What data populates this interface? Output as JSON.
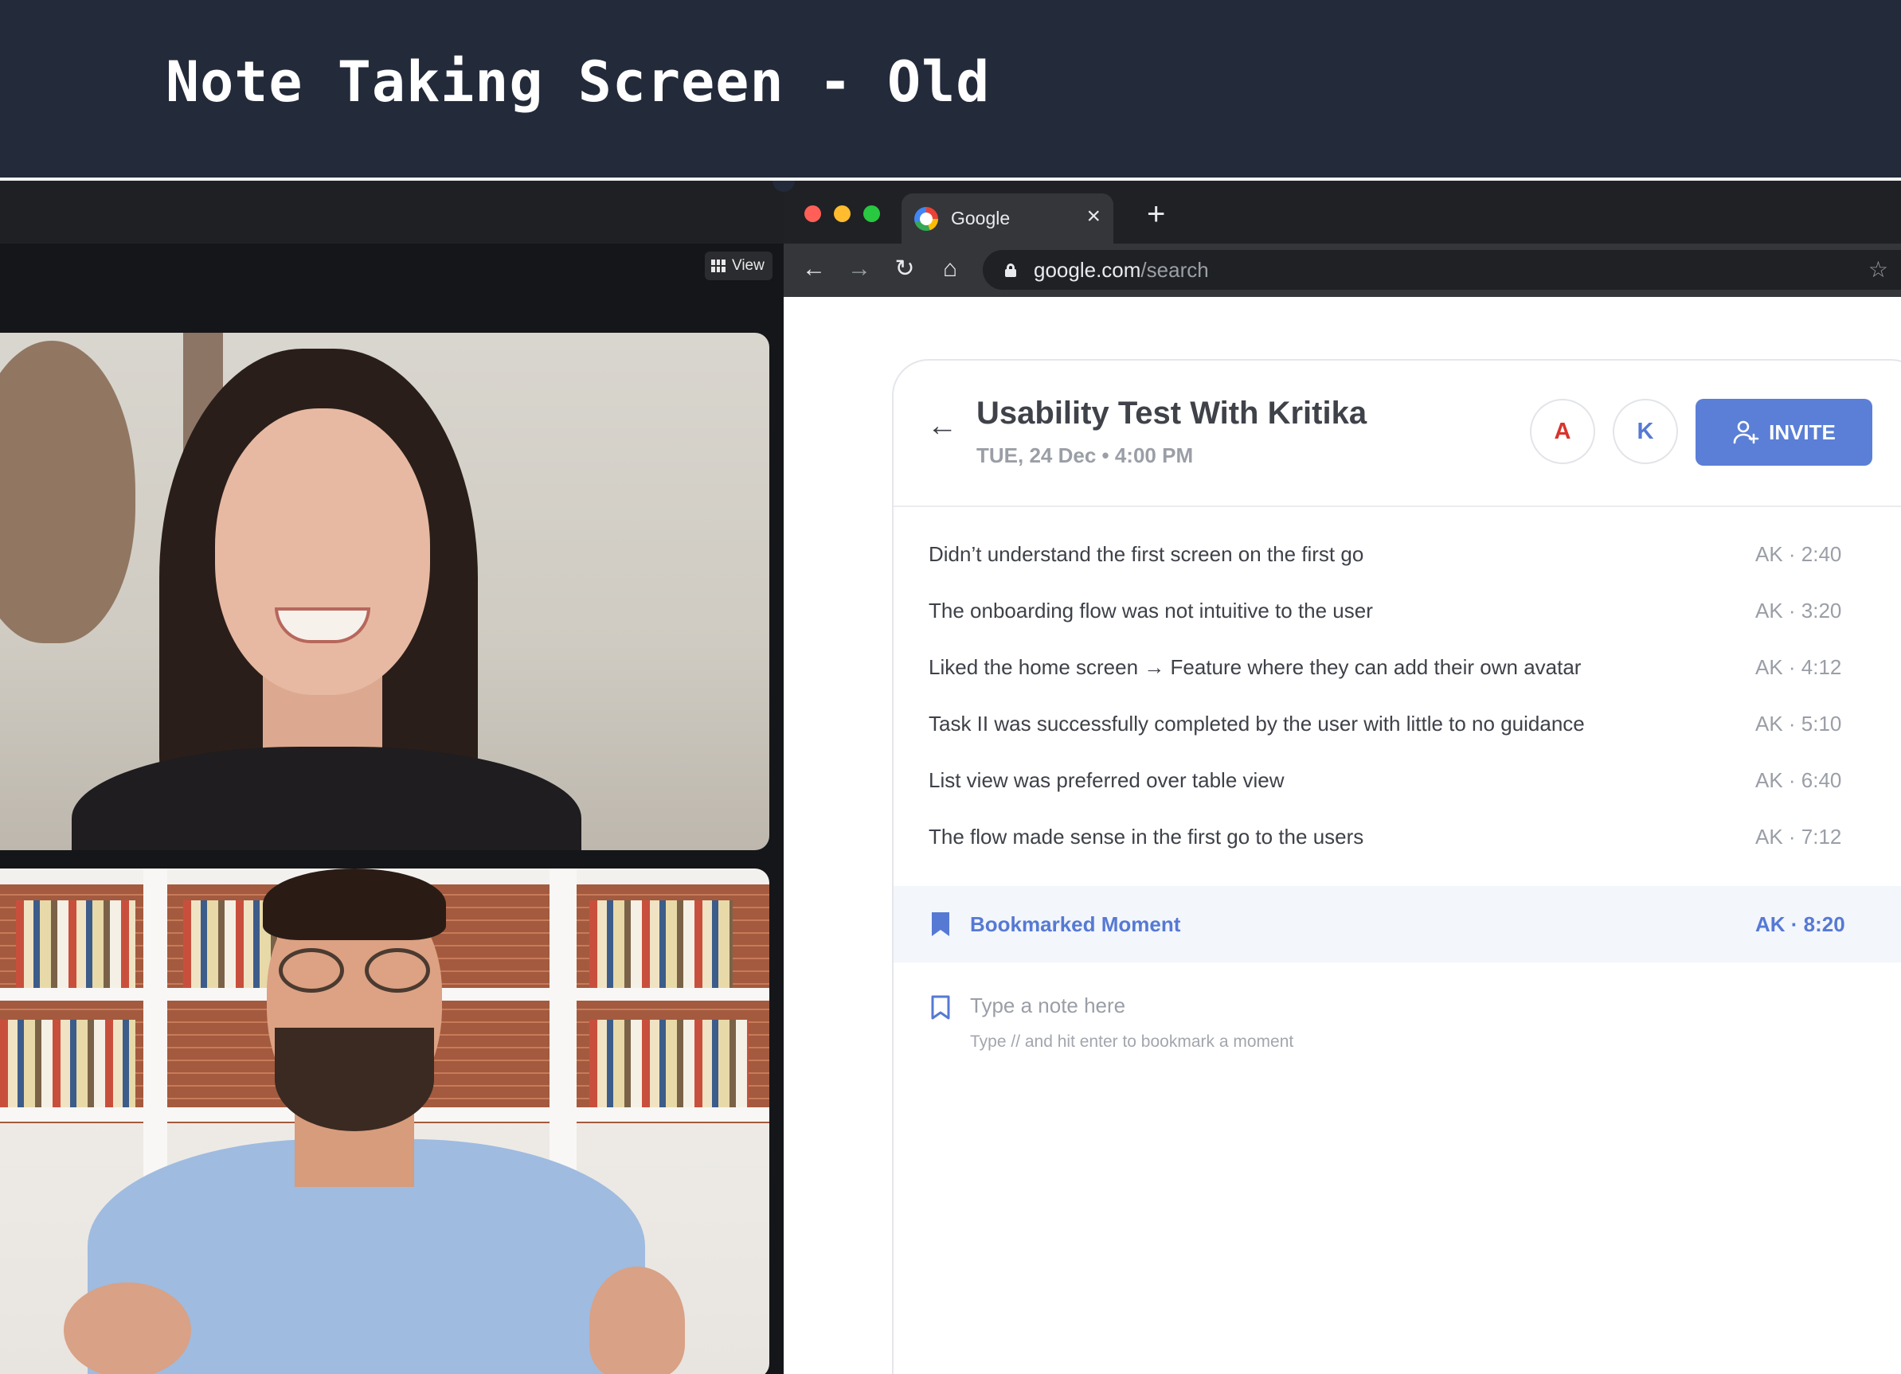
{
  "page": {
    "title": "Note Taking Screen - Old"
  },
  "call": {
    "view_label": "View"
  },
  "browser": {
    "tab_title": "Google",
    "url_host": "google.com",
    "url_path": "/search"
  },
  "session": {
    "title": "Usability Test With Kritika",
    "date": "TUE, 24 Dec • 4:00 PM",
    "avatars": [
      "A",
      "K"
    ],
    "invite_label": "INVITE"
  },
  "notes": [
    {
      "text": "Didn’t understand the first screen on the first go",
      "meta": "AK · 2:40"
    },
    {
      "text": "The onboarding flow was not intuitive to the user",
      "meta": "AK · 3:20"
    },
    {
      "text": "Liked the home screen → Feature where they can add their own avatar",
      "meta": "AK · 4:12"
    },
    {
      "text": "Task II was successfully completed by the user with little to no guidance",
      "meta": "AK · 5:10"
    },
    {
      "text": "List view was preferred over table view",
      "meta": "AK · 6:40"
    },
    {
      "text": "The flow made sense in the first go to the users",
      "meta": "AK · 7:12"
    }
  ],
  "bookmark": {
    "text": "Bookmarked Moment",
    "meta": "AK · 8:20"
  },
  "note_input": {
    "placeholder": "Type a note here",
    "hint": "Type // and hit enter to bookmark a moment"
  },
  "colors": {
    "accent": "#5b7fd6",
    "avatar_a": "#d8342c",
    "header_bg": "#232a3a"
  },
  "icons": [
    "grid-view-icon",
    "back-arrow-icon",
    "forward-arrow-icon",
    "reload-icon",
    "home-icon",
    "lock-icon",
    "star-icon",
    "close-icon",
    "plus-icon",
    "user-plus-icon",
    "bookmark-filled-icon",
    "bookmark-outline-icon"
  ]
}
